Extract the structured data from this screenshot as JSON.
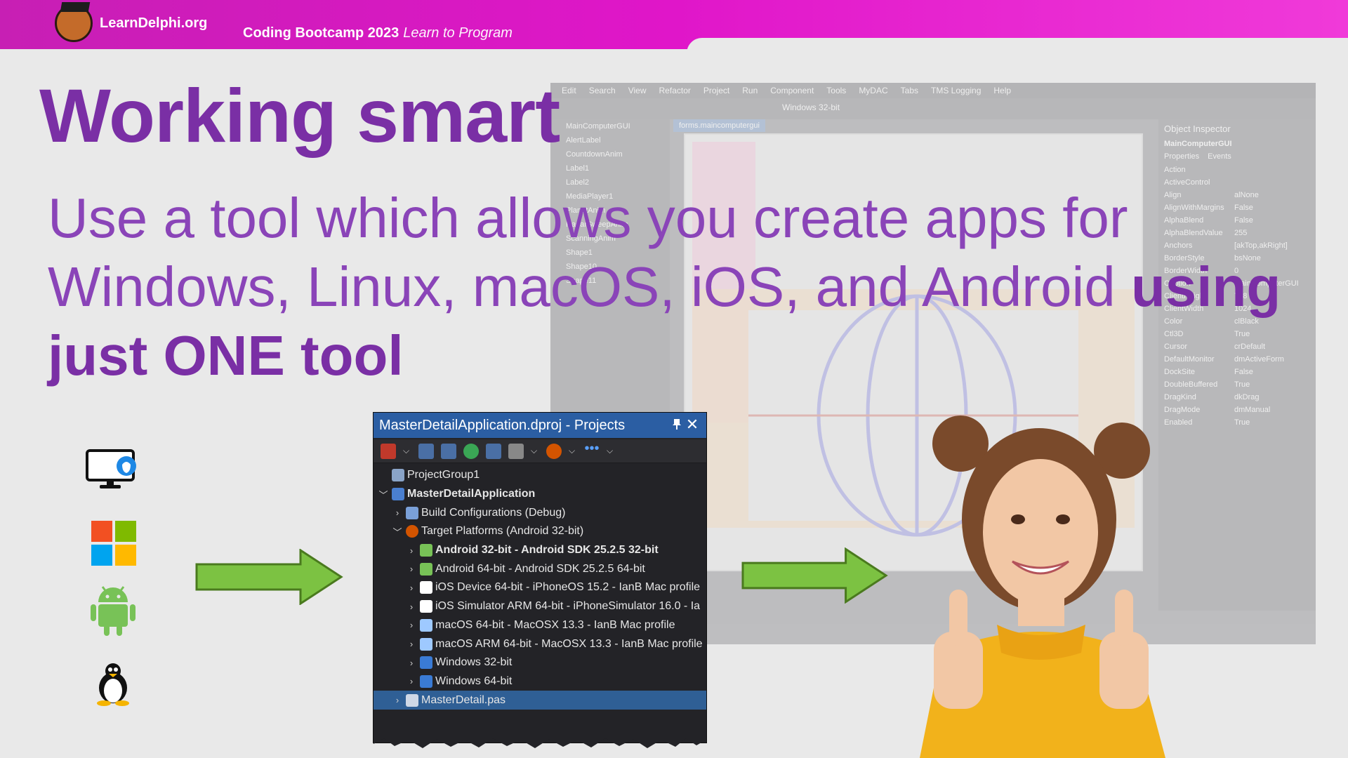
{
  "banner": {
    "brand": "LearnDelphi.org",
    "bootcamp_title": "Coding Bootcamp 2023",
    "bootcamp_tagline": "Learn to Program",
    "colors": {
      "start": "#c71fb4",
      "end": "#f03ad9"
    }
  },
  "slide": {
    "title": "Working smart",
    "subtitle_line1": "Use a tool which allows you create apps for",
    "subtitle_line2_plain": "Windows, Linux, macOS, iOS, and Android",
    "subtitle_line2_bold": "using",
    "subtitle_line3_bold": "just ONE tool",
    "accent": "#7a2fa5"
  },
  "platform_icons": [
    "macos-icon",
    "windows-icon",
    "android-icon",
    "linux-icon"
  ],
  "ide_bg": {
    "menu": [
      "Edit",
      "Search",
      "View",
      "Refactor",
      "Project",
      "Run",
      "Component",
      "Tools",
      "MyDAC",
      "Tabs",
      "TMS Logging",
      "Help"
    ],
    "platform_combo": "Windows 32-bit",
    "form_tab": "forms.maincomputergui",
    "structure_items": [
      "MainComputerGUI",
      "AlertLabel",
      "CountdownAnim",
      "Label1",
      "Label2",
      "MediaPlayer1",
      "PlanetAnim",
      "RadarSweepAnim",
      "ScanningAnim",
      "Shape1",
      "Shape10",
      "Shape11"
    ],
    "inspector_title": "Object Inspector",
    "inspector_object": "MainComputerGUI",
    "inspector_tabs": [
      "Properties",
      "Events"
    ],
    "inspector_rows": [
      {
        "k": "Action",
        "v": ""
      },
      {
        "k": "ActiveControl",
        "v": ""
      },
      {
        "k": "Align",
        "v": "alNone"
      },
      {
        "k": "AlignWithMargins",
        "v": "False"
      },
      {
        "k": "AlphaBlend",
        "v": "False"
      },
      {
        "k": "AlphaBlendValue",
        "v": "255"
      },
      {
        "k": "Anchors",
        "v": "[akTop,akRight]"
      },
      {
        "k": "BorderStyle",
        "v": "bsNone"
      },
      {
        "k": "BorderWidth",
        "v": "0"
      },
      {
        "k": "Caption",
        "v": "MainComputerGUI"
      },
      {
        "k": "ClientHeight",
        "v": "768"
      },
      {
        "k": "ClientWidth",
        "v": "1024"
      },
      {
        "k": "Color",
        "v": "clBlack"
      },
      {
        "k": "Ctl3D",
        "v": "True"
      },
      {
        "k": "Cursor",
        "v": "crDefault"
      },
      {
        "k": "DefaultMonitor",
        "v": "dmActiveForm"
      },
      {
        "k": "DockSite",
        "v": "False"
      },
      {
        "k": "DoubleBuffered",
        "v": "True"
      },
      {
        "k": "DragKind",
        "v": "dkDrag"
      },
      {
        "k": "DragMode",
        "v": "dmManual"
      },
      {
        "k": "Enabled",
        "v": "True"
      }
    ]
  },
  "projects_panel": {
    "title": "MasterDetailApplication.dproj - Projects",
    "close_glyph": "✕",
    "tree": [
      {
        "label": "ProjectGroup1",
        "level": 0,
        "expander": "",
        "icon": "project-group-icon",
        "bold": false,
        "selected": false
      },
      {
        "label": "MasterDetailApplication",
        "level": 0,
        "expander": "﹀",
        "icon": "project-icon",
        "bold": true,
        "selected": false
      },
      {
        "label": "Build Configurations (Debug)",
        "level": 1,
        "expander": "›",
        "icon": "build-config-icon",
        "bold": false,
        "selected": false
      },
      {
        "label": "Target Platforms (Android 32-bit)",
        "level": 1,
        "expander": "﹀",
        "icon": "target-platforms-icon",
        "bold": false,
        "selected": false
      },
      {
        "label": "Android 32-bit - Android SDK 25.2.5 32-bit",
        "level": 2,
        "expander": "›",
        "icon": "android-icon",
        "bold": true,
        "selected": false
      },
      {
        "label": "Android 64-bit - Android SDK 25.2.5 64-bit",
        "level": 2,
        "expander": "›",
        "icon": "android-icon",
        "bold": false,
        "selected": false
      },
      {
        "label": "iOS Device 64-bit - iPhoneOS 15.2 - IanB Mac profile",
        "level": 2,
        "expander": "›",
        "icon": "ios-device-icon",
        "bold": false,
        "selected": false
      },
      {
        "label": "iOS Simulator ARM 64-bit - iPhoneSimulator 16.0 - Ia",
        "level": 2,
        "expander": "›",
        "icon": "ios-device-icon",
        "bold": false,
        "selected": false
      },
      {
        "label": "macOS 64-bit - MacOSX 13.3 - IanB Mac profile",
        "level": 2,
        "expander": "›",
        "icon": "macos-monitor-icon",
        "bold": false,
        "selected": false
      },
      {
        "label": "macOS ARM 64-bit - MacOSX 13.3 - IanB Mac profile",
        "level": 2,
        "expander": "›",
        "icon": "macos-monitor-icon",
        "bold": false,
        "selected": false
      },
      {
        "label": "Windows 32-bit",
        "level": 2,
        "expander": "›",
        "icon": "windows-icon",
        "bold": false,
        "selected": false
      },
      {
        "label": "Windows 64-bit",
        "level": 2,
        "expander": "›",
        "icon": "windows-icon",
        "bold": false,
        "selected": false
      },
      {
        "label": "MasterDetail.pas",
        "level": 1,
        "expander": "›",
        "icon": "pas-file-icon",
        "bold": false,
        "selected": true
      }
    ],
    "colors": {
      "title_bg": "#2b5ea3",
      "panel_bg": "#232327",
      "selected": "#2f5f95"
    }
  }
}
